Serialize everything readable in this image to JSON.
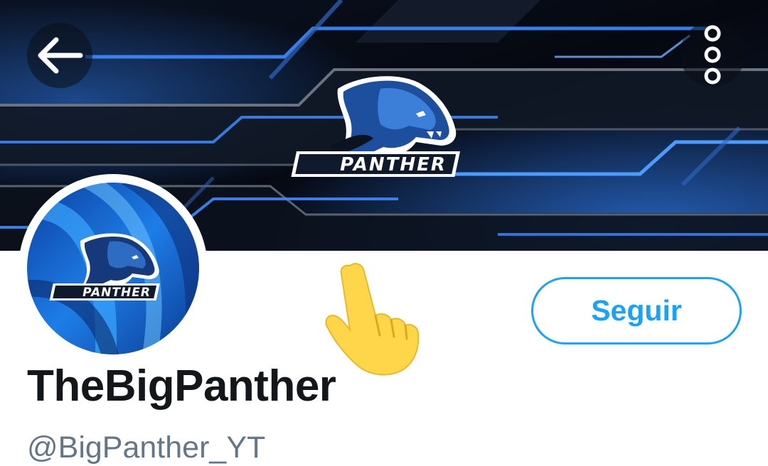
{
  "profile": {
    "display_name": "TheBigPanther",
    "handle": "@BigPanther_YT",
    "follow_label": "Seguir",
    "banner_logo_text": "PANTHER",
    "avatar_logo_text": "PANTHER"
  },
  "icons": {
    "back": "arrow-left-icon",
    "menu": "more-vertical-icon",
    "pointer": "pointing-hand-emoji"
  },
  "colors": {
    "accent": "#1da1f2",
    "name_text": "#14171a",
    "handle_text": "#657786",
    "banner_dark": "#0b1220",
    "banner_blue": "#2f7be8",
    "emoji_yellow": "#ffd54a"
  }
}
